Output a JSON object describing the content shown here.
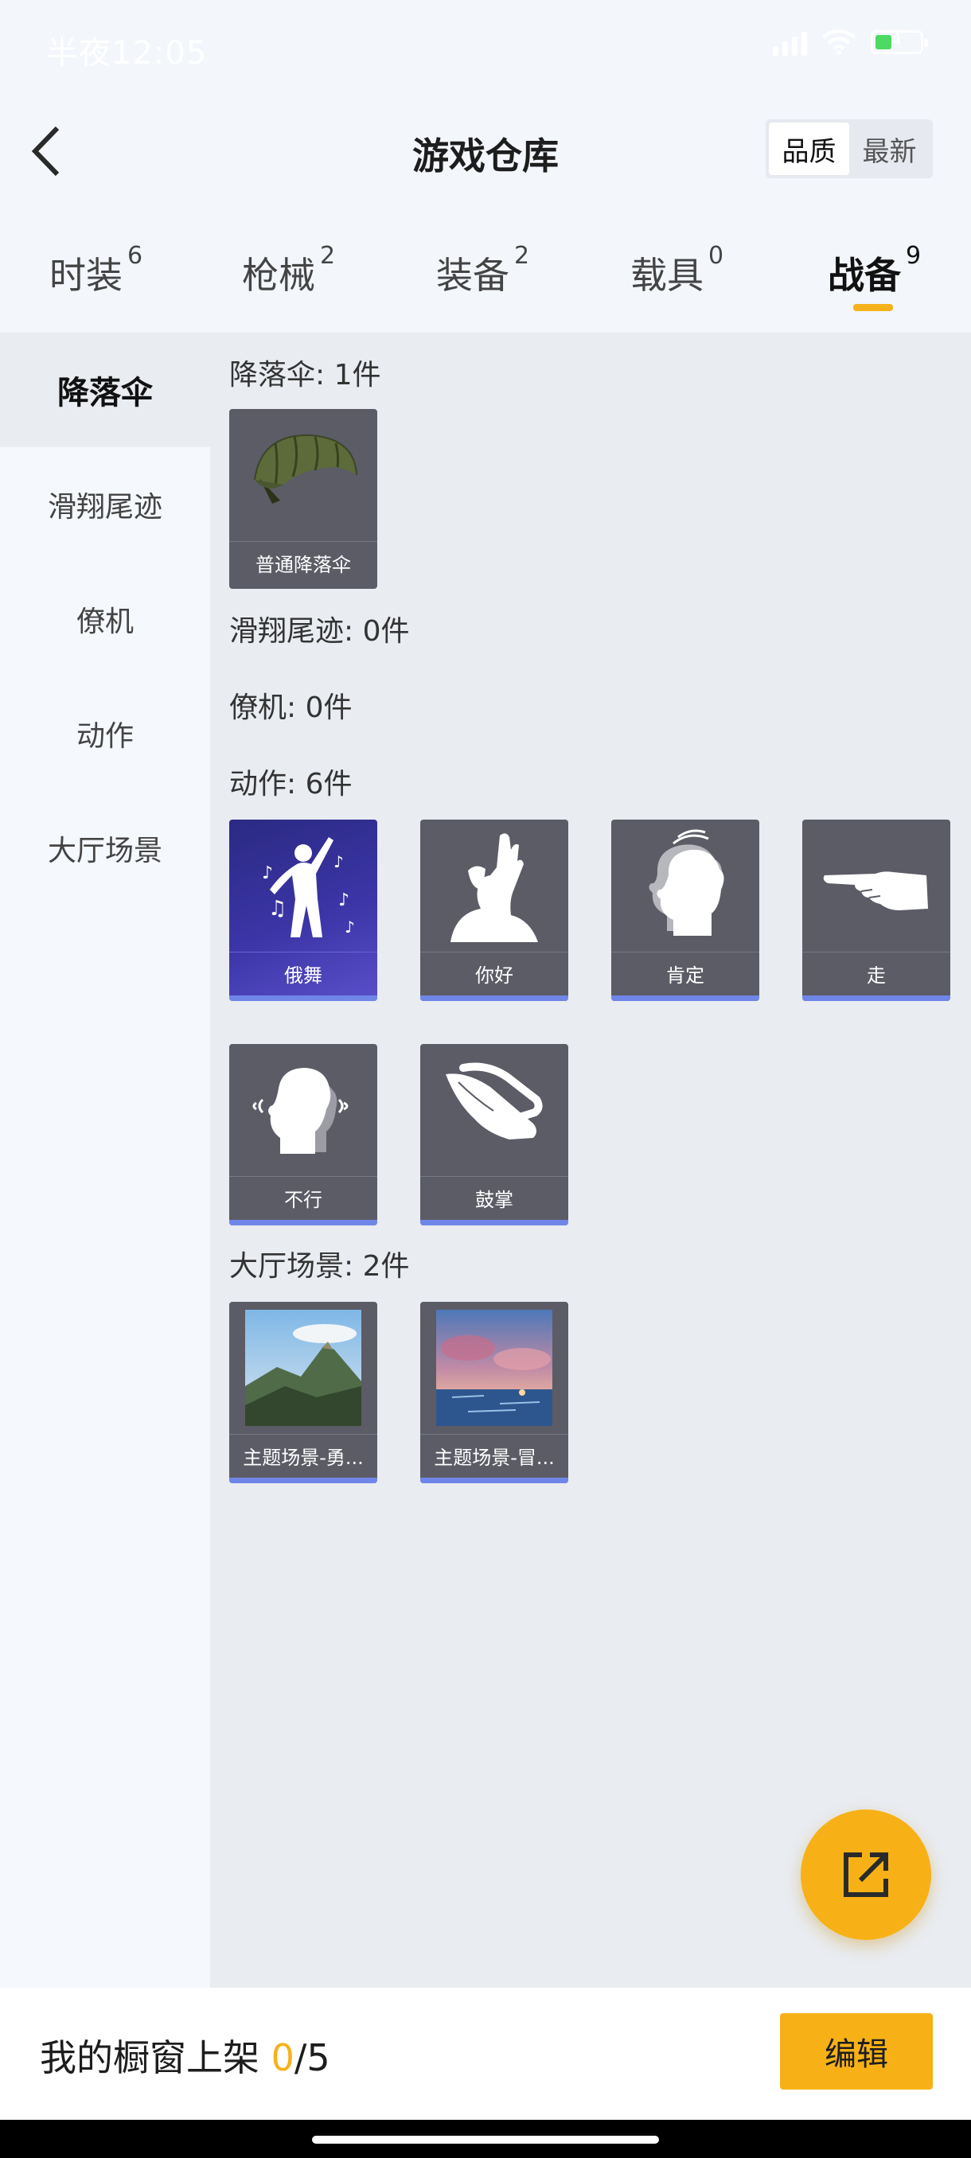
{
  "status_bar": {
    "time": "半夜12:05",
    "battery": "4"
  },
  "header": {
    "title": "游戏仓库",
    "sort_options": [
      "品质",
      "最新"
    ],
    "active_sort": "品质"
  },
  "tabs": [
    {
      "label": "时装",
      "count": "6"
    },
    {
      "label": "枪械",
      "count": "2"
    },
    {
      "label": "装备",
      "count": "2"
    },
    {
      "label": "载具",
      "count": "0"
    },
    {
      "label": "战备",
      "count": "9"
    }
  ],
  "active_tab": "战备",
  "sidebar": {
    "items": [
      "降落伞",
      "滑翔尾迹",
      "僚机",
      "动作",
      "大厅场景"
    ],
    "active": "降落伞"
  },
  "sections": {
    "parachute": {
      "title": "降落伞: 1件",
      "items": [
        "普通降落伞"
      ]
    },
    "trail": {
      "title": "滑翔尾迹: 0件"
    },
    "wingman": {
      "title": "僚机: 0件"
    },
    "emote": {
      "title": "动作: 6件",
      "items": [
        "俄舞",
        "你好",
        "肯定",
        "走",
        "不行",
        "鼓掌"
      ]
    },
    "lobby": {
      "title": "大厅场景: 2件",
      "items": [
        "主题场景-勇...",
        "主题场景-冒..."
      ]
    }
  },
  "bottom_bar": {
    "label": "我的橱窗上架 ",
    "listed": "0",
    "total": "/5",
    "edit_label": "编辑"
  },
  "colors": {
    "accent": "#f7b116",
    "card_bg": "#5b5c66",
    "quality_bar": "#6f86e8",
    "purple_card": "#3b35a7"
  }
}
